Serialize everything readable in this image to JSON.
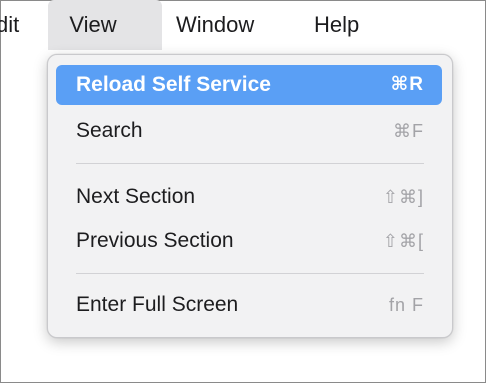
{
  "menubar": {
    "items": [
      {
        "label": "dit"
      },
      {
        "label": "View"
      },
      {
        "label": "Window"
      },
      {
        "label": "Help"
      }
    ]
  },
  "view_menu": {
    "items": [
      {
        "label": "Reload Self Service",
        "shortcut": "⌘R",
        "highlighted": true
      },
      {
        "label": "Search",
        "shortcut": "⌘F"
      },
      {
        "label": "Next Section",
        "shortcut": "⇧⌘]"
      },
      {
        "label": "Previous Section",
        "shortcut": "⇧⌘["
      },
      {
        "label": "Enter Full Screen",
        "shortcut": "fn F"
      }
    ]
  },
  "colors": {
    "highlight": "#5a9ff5",
    "menu_background": "#f2f2f3",
    "shortcut_text": "#a3a3a7",
    "active_menu_title_bg": "#e4e4e6"
  }
}
